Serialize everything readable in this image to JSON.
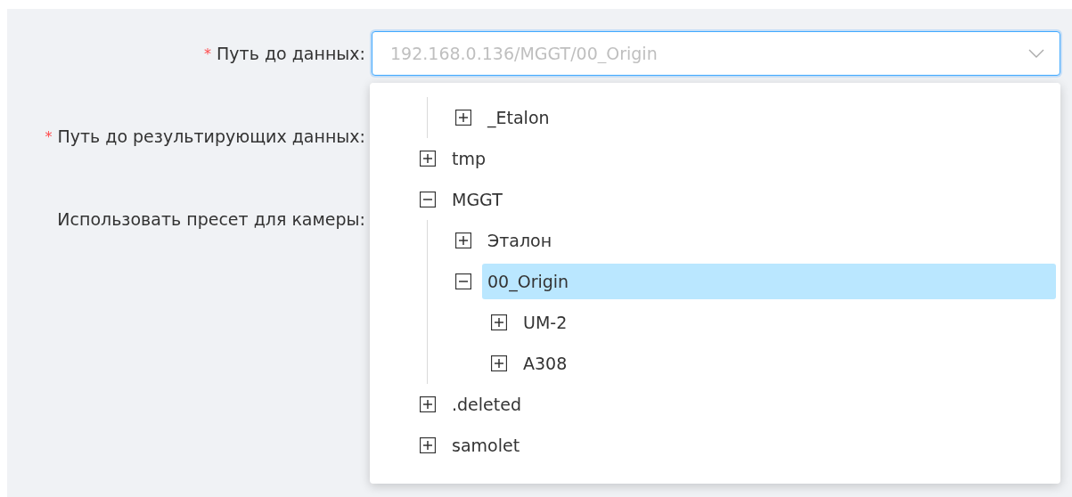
{
  "form": {
    "fields": [
      {
        "label": "Путь до данных:",
        "required_mark": "*",
        "placeholder": "192.168.0.136/MGGT/00_Origin",
        "focused": true
      },
      {
        "label": "Путь до результирующих данных:",
        "required_mark": "*"
      },
      {
        "label": "Использовать пресет для камеры:"
      }
    ]
  },
  "dropdown": {
    "tree": [
      {
        "children": [
          {
            "label": "_Etalon",
            "expanded": false,
            "selected": false
          }
        ]
      },
      {
        "label": "tmp",
        "expanded": false,
        "selected": false
      },
      {
        "label": "MGGT",
        "expanded": true,
        "selected": false,
        "children": [
          {
            "label": "Эталон",
            "expanded": false,
            "selected": false
          },
          {
            "label": "00_Origin",
            "expanded": true,
            "selected": true,
            "children": [
              {
                "label": "UM-2",
                "expanded": false,
                "selected": false
              },
              {
                "label": "A308",
                "expanded": false,
                "selected": false
              }
            ]
          }
        ]
      },
      {
        "label": ".deleted",
        "expanded": false,
        "selected": false
      },
      {
        "label": "samolet",
        "expanded": false,
        "selected": false
      }
    ]
  }
}
